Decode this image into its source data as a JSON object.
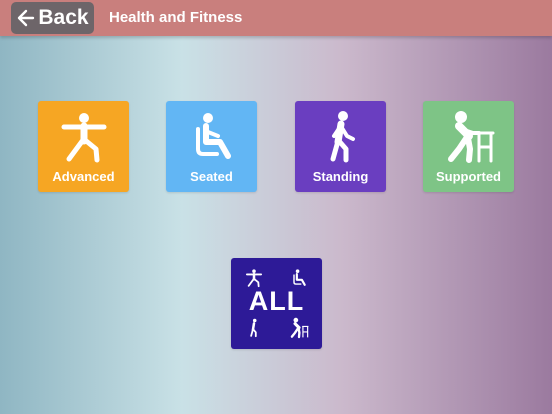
{
  "header": {
    "back_label": "Back",
    "title": "Health and Fitness"
  },
  "categories": [
    {
      "label": "Advanced",
      "icon": "yoga-pose-icon",
      "color": "#f6a623"
    },
    {
      "label": "Seated",
      "icon": "seated-person-icon",
      "color": "#62b6f4"
    },
    {
      "label": "Standing",
      "icon": "walking-person-icon",
      "color": "#6a3ec0"
    },
    {
      "label": "Supported",
      "icon": "walker-person-icon",
      "color": "#7ec486"
    }
  ],
  "all_tile": {
    "label": "ALL",
    "color": "#2d1a97"
  },
  "colors": {
    "topbar": "#c97f7d",
    "back_button": "#6d6569"
  }
}
